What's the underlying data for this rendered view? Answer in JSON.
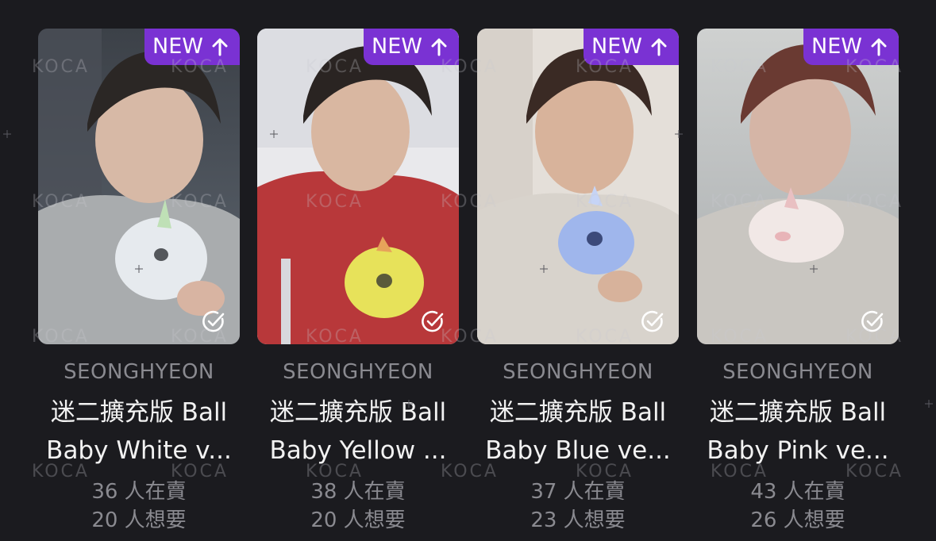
{
  "watermark": "KOCA",
  "colors": {
    "background": "#1b1b1f",
    "badge": "#7a32d3",
    "artist_text": "#8a8a90",
    "title_text": "#f2f2f2",
    "stats_text": "#8a8a90"
  },
  "cards": [
    {
      "badge": "NEW",
      "badge_icon": "arrow-up-icon",
      "check_icon": "check-circle-icon",
      "artist": "SEONGHYEON",
      "title_line1": "迷二擴充版 Ball",
      "title_line2": "Baby White v...",
      "selling": "36 人在賣",
      "wanting": "20 人想要",
      "shirt_color": "#a9acae",
      "plush_color": "#e6eaee"
    },
    {
      "badge": "NEW",
      "badge_icon": "arrow-up-icon",
      "check_icon": "check-circle-icon",
      "artist": "SEONGHYEON",
      "title_line1": "迷二擴充版 Ball",
      "title_line2": "Baby Yellow ...",
      "selling": "38 人在賣",
      "wanting": "20 人想要",
      "shirt_color": "#b8383a",
      "plush_color": "#e7e25a"
    },
    {
      "badge": "NEW",
      "badge_icon": "arrow-up-icon",
      "check_icon": "check-circle-icon",
      "artist": "SEONGHYEON",
      "title_line1": "迷二擴充版 Ball",
      "title_line2": "Baby Blue ve...",
      "selling": "37 人在賣",
      "wanting": "23 人想要",
      "shirt_color": "#d8d3cc",
      "plush_color": "#9fb6ec"
    },
    {
      "badge": "NEW",
      "badge_icon": "arrow-up-icon",
      "check_icon": "check-circle-icon",
      "artist": "SEONGHYEON",
      "title_line1": "迷二擴充版 Ball",
      "title_line2": "Baby Pink ve...",
      "selling": "43 人在賣",
      "wanting": "26 人想要",
      "shirt_color": "#c9c6c1",
      "plush_color": "#f1e8e6"
    }
  ]
}
